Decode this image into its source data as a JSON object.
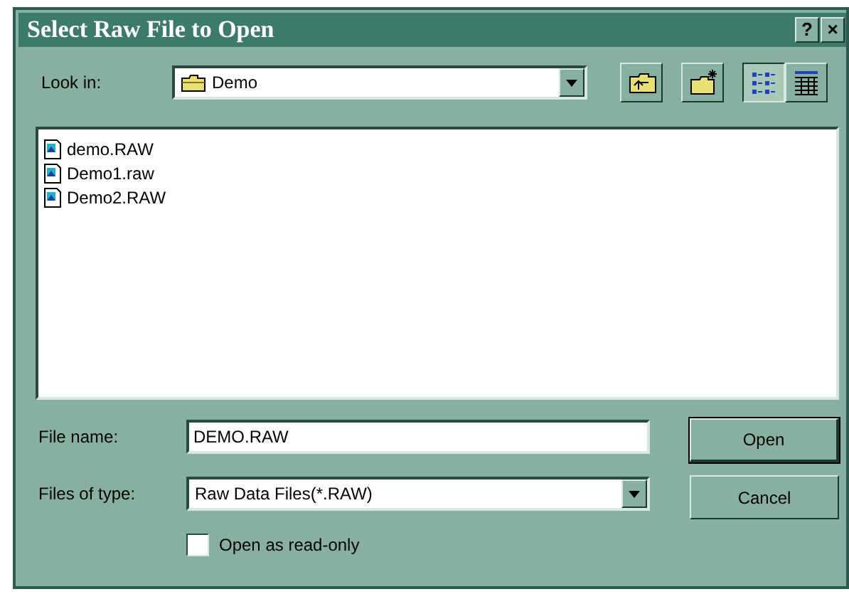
{
  "window": {
    "title": "Select Raw File to Open",
    "controls": [
      "?",
      "×"
    ]
  },
  "look_in": {
    "label": "Look in:",
    "value": "Demo"
  },
  "toolbar": [
    {
      "kind": "up",
      "selected": false
    },
    {
      "kind": "new-folder",
      "selected": false
    },
    {
      "kind": "list",
      "selected": true
    },
    {
      "kind": "details",
      "selected": false
    }
  ],
  "files": [
    {
      "name": "demo.RAW",
      "selected": false
    },
    {
      "name": "Demo1.raw",
      "selected": false
    },
    {
      "name": "Demo2.RAW",
      "selected": false
    }
  ],
  "file_name": {
    "label": "File name:",
    "value": "DEMO.RAW"
  },
  "file_type": {
    "label": "Files of type:",
    "value": "Raw Data Files(*.RAW)"
  },
  "read_only": {
    "label": "Open as read-only",
    "checked": false
  },
  "buttons": [
    {
      "label": "Open",
      "default": true
    },
    {
      "label": "Cancel",
      "default": false
    }
  ]
}
